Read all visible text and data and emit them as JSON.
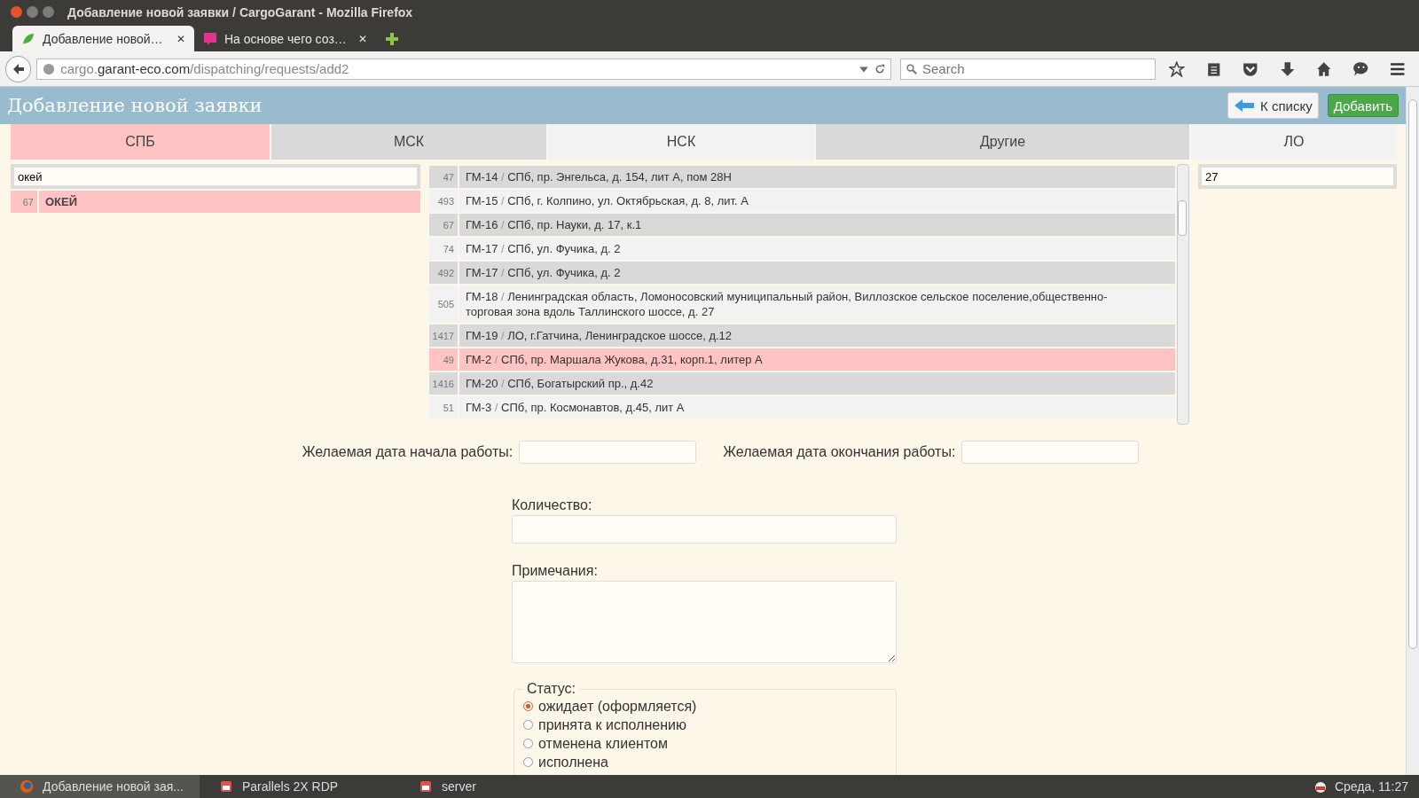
{
  "window": {
    "title": "Добавление новой заявки / CargoGarant - Mozilla Firefox"
  },
  "browser_tabs": [
    {
      "label": "Добавление новой…",
      "close": "✕",
      "selected": true
    },
    {
      "label": "На основе чего соз…",
      "close": "✕",
      "selected": false
    }
  ],
  "address_bar": {
    "host_prefix": "cargo.",
    "host": "garant-eco.com",
    "path": "/dispatching/requests/add2"
  },
  "search": {
    "placeholder": "Search"
  },
  "page": {
    "title": "Добавление новой заявки",
    "back_button": "К списку",
    "add_button": "Добавить"
  },
  "region_tabs": [
    {
      "label": "СПБ",
      "selected": true
    },
    {
      "label": "МСК",
      "selected": false
    },
    {
      "label": "НСК",
      "selected": false
    },
    {
      "label": "Другие",
      "selected": false
    },
    {
      "label": "ЛО",
      "selected": false
    }
  ],
  "client_filter": {
    "value": "окей"
  },
  "clients": [
    {
      "id": "67",
      "name": "ОКЕЙ",
      "selected": true
    }
  ],
  "addresses": [
    {
      "id": "47",
      "code": "ГМ-14",
      "address": "СПб, пр. Энгельса, д. 154, лит А, пом 28Н",
      "selected": false
    },
    {
      "id": "493",
      "code": "ГМ-15",
      "address": "СПб, г. Колпино, ул. Октябрьская, д. 8, лит. А",
      "selected": false
    },
    {
      "id": "67",
      "code": "ГМ-16",
      "address": "СПб, пр. Науки, д. 17, к.1",
      "selected": false
    },
    {
      "id": "74",
      "code": "ГМ-17",
      "address": "СПб, ул. Фучика, д. 2",
      "selected": false
    },
    {
      "id": "492",
      "code": "ГМ-17",
      "address": "СПб, ул. Фучика, д. 2",
      "selected": false
    },
    {
      "id": "505",
      "code": "ГМ-18",
      "address": "Ленинградская область, Ломоносовский муниципальный район, Виллозское сельское поселение,общественно-торговая зона вдоль Таллинского шоссе, д. 27",
      "selected": false
    },
    {
      "id": "1417",
      "code": "ГМ-19",
      "address": "ЛО, г.Гатчина, Ленинградское шоссе, д.12",
      "selected": false
    },
    {
      "id": "49",
      "code": "ГМ-2",
      "address": "СПб, пр. Маршала Жукова, д.31, корп.1, литер А",
      "selected": true
    },
    {
      "id": "1416",
      "code": "ГМ-20",
      "address": "СПб, Богатырский пр., д.42",
      "selected": false
    },
    {
      "id": "51",
      "code": "ГМ-3",
      "address": "СПб, пр. Космонавтов, д.45, лит А",
      "selected": false
    }
  ],
  "address_separator": "/",
  "right_filter": {
    "value": "27"
  },
  "form": {
    "start_label": "Желаемая дата начала работы:",
    "end_label": "Желаемая дата окончания работы:",
    "quantity_label": "Количество:",
    "notes_label": "Примечания:"
  },
  "status": {
    "legend": "Статус:",
    "options": [
      {
        "label": "ожидает (оформляется)",
        "selected": true
      },
      {
        "label": "принята к исполнению",
        "selected": false
      },
      {
        "label": "отменена клиентом",
        "selected": false
      },
      {
        "label": "исполнена",
        "selected": false
      }
    ]
  },
  "taskbar": {
    "items": [
      {
        "label": "Добавление новой зая...",
        "kind": "firefox"
      },
      {
        "label": "Parallels 2X RDP",
        "kind": "app"
      },
      {
        "label": "server",
        "kind": "app"
      }
    ],
    "clock": "Среда, 11:27"
  }
}
